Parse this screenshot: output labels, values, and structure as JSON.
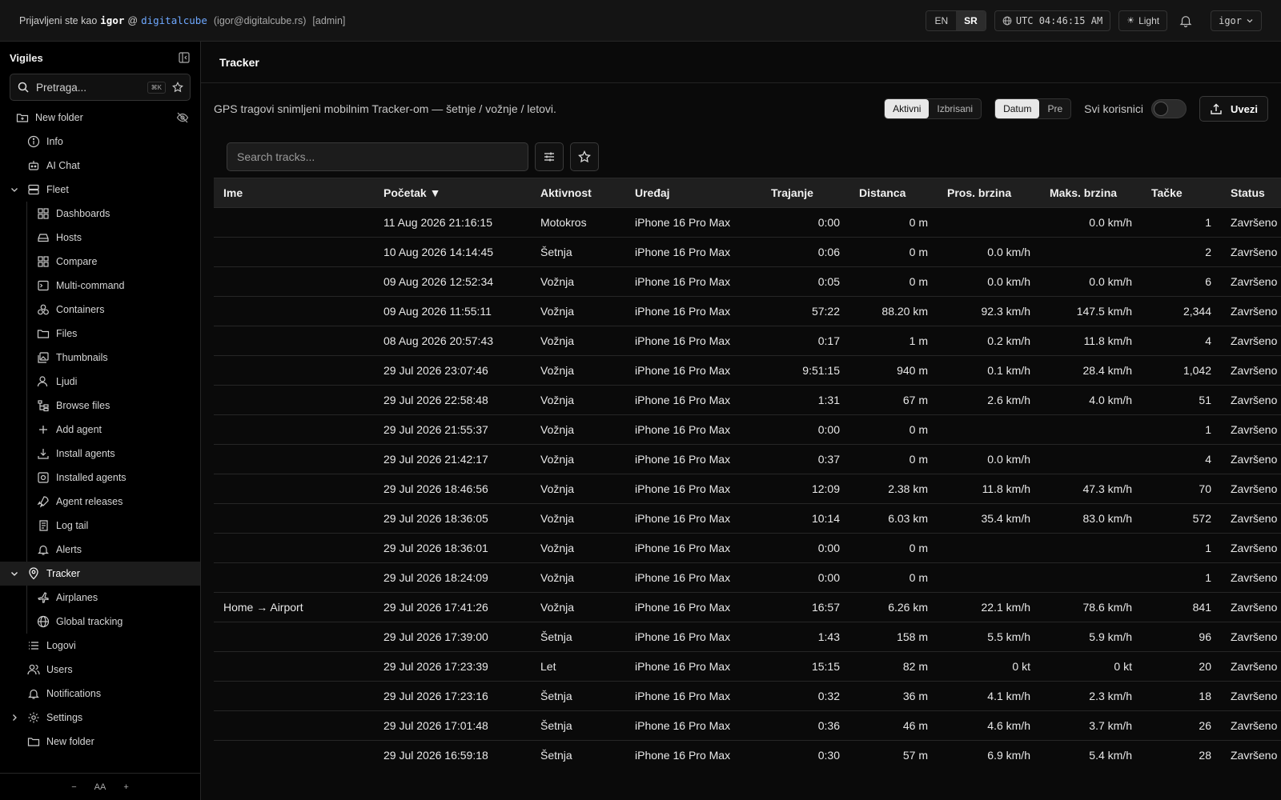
{
  "topbar": {
    "prefix": "Prijavljeni ste kao",
    "user": "igor",
    "at": "@",
    "org": "digitalcube",
    "email": "(igor@digitalcube.rs)",
    "role": "[admin]",
    "lang_en": "EN",
    "lang_sr": "SR",
    "clock": "UTC 04:46:15 AM",
    "theme": "Light",
    "user_menu": "igor"
  },
  "sidebar": {
    "brand": "Vigiles",
    "search_placeholder": "Pretraga...",
    "search_kbd": "⌘K",
    "items": [
      {
        "label": "New folder"
      },
      {
        "label": "Info"
      },
      {
        "label": "AI Chat"
      },
      {
        "label": "Fleet"
      },
      {
        "label": "Dashboards"
      },
      {
        "label": "Hosts"
      },
      {
        "label": "Compare"
      },
      {
        "label": "Multi-command"
      },
      {
        "label": "Containers"
      },
      {
        "label": "Files"
      },
      {
        "label": "Thumbnails"
      },
      {
        "label": "Ljudi"
      },
      {
        "label": "Browse files"
      },
      {
        "label": "Add agent"
      },
      {
        "label": "Install agents"
      },
      {
        "label": "Installed agents"
      },
      {
        "label": "Agent releases"
      },
      {
        "label": "Log tail"
      },
      {
        "label": "Alerts"
      },
      {
        "label": "Tracker"
      },
      {
        "label": "Airplanes"
      },
      {
        "label": "Global tracking"
      },
      {
        "label": "Logovi"
      },
      {
        "label": "Users"
      },
      {
        "label": "Notifications"
      },
      {
        "label": "Settings"
      },
      {
        "label": "New folder"
      }
    ],
    "footer": {
      "minus": "−",
      "aa": "AA",
      "plus": "+"
    }
  },
  "main": {
    "title": "Tracker",
    "description": "GPS tragovi snimljeni mobilnim Tracker-om — šetnje / vožnje / letovi.",
    "filter_active": "Aktivni",
    "filter_deleted": "Izbrisani",
    "sort_date": "Datum",
    "sort_before": "Pre",
    "all_users_label": "Svi korisnici",
    "import_label": "Uvezi",
    "search_placeholder": "Search tracks...",
    "columns": [
      "Ime",
      "Početak ▼",
      "Aktivnost",
      "Uređaj",
      "Trajanje",
      "Distanca",
      "Pros. brzina",
      "Maks. brzina",
      "Tačke",
      "Status"
    ],
    "rows": [
      {
        "name": "",
        "start": "11 Aug 2026 21:16:15",
        "activity": "Motokros",
        "device": "iPhone 16 Pro Max",
        "duration": "0:00",
        "distance": "0 m",
        "avg": "",
        "max": "0.0 km/h",
        "points": "1",
        "status": "Završeno"
      },
      {
        "name": "",
        "start": "10 Aug 2026 14:14:45",
        "activity": "Šetnja",
        "device": "iPhone 16 Pro Max",
        "duration": "0:06",
        "distance": "0 m",
        "avg": "0.0 km/h",
        "max": "",
        "points": "2",
        "status": "Završeno"
      },
      {
        "name": "",
        "start": "09 Aug 2026 12:52:34",
        "activity": "Vožnja",
        "device": "iPhone 16 Pro Max",
        "duration": "0:05",
        "distance": "0 m",
        "avg": "0.0 km/h",
        "max": "0.0 km/h",
        "points": "6",
        "status": "Završeno"
      },
      {
        "name": "",
        "start": "09 Aug 2026 11:55:11",
        "activity": "Vožnja",
        "device": "iPhone 16 Pro Max",
        "duration": "57:22",
        "distance": "88.20 km",
        "avg": "92.3 km/h",
        "max": "147.5 km/h",
        "points": "2,344",
        "status": "Završeno"
      },
      {
        "name": "",
        "start": "08 Aug 2026 20:57:43",
        "activity": "Vožnja",
        "device": "iPhone 16 Pro Max",
        "duration": "0:17",
        "distance": "1 m",
        "avg": "0.2 km/h",
        "max": "11.8 km/h",
        "points": "4",
        "status": "Završeno"
      },
      {
        "name": "",
        "start": "29 Jul 2026 23:07:46",
        "activity": "Vožnja",
        "device": "iPhone 16 Pro Max",
        "duration": "9:51:15",
        "distance": "940 m",
        "avg": "0.1 km/h",
        "max": "28.4 km/h",
        "points": "1,042",
        "status": "Završeno"
      },
      {
        "name": "",
        "start": "29 Jul 2026 22:58:48",
        "activity": "Vožnja",
        "device": "iPhone 16 Pro Max",
        "duration": "1:31",
        "distance": "67 m",
        "avg": "2.6 km/h",
        "max": "4.0 km/h",
        "points": "51",
        "status": "Završeno"
      },
      {
        "name": "",
        "start": "29 Jul 2026 21:55:37",
        "activity": "Vožnja",
        "device": "iPhone 16 Pro Max",
        "duration": "0:00",
        "distance": "0 m",
        "avg": "",
        "max": "",
        "points": "1",
        "status": "Završeno"
      },
      {
        "name": "",
        "start": "29 Jul 2026 21:42:17",
        "activity": "Vožnja",
        "device": "iPhone 16 Pro Max",
        "duration": "0:37",
        "distance": "0 m",
        "avg": "0.0 km/h",
        "max": "",
        "points": "4",
        "status": "Završeno"
      },
      {
        "name": "",
        "start": "29 Jul 2026 18:46:56",
        "activity": "Vožnja",
        "device": "iPhone 16 Pro Max",
        "duration": "12:09",
        "distance": "2.38 km",
        "avg": "11.8 km/h",
        "max": "47.3 km/h",
        "points": "70",
        "status": "Završeno"
      },
      {
        "name": "",
        "start": "29 Jul 2026 18:36:05",
        "activity": "Vožnja",
        "device": "iPhone 16 Pro Max",
        "duration": "10:14",
        "distance": "6.03 km",
        "avg": "35.4 km/h",
        "max": "83.0 km/h",
        "points": "572",
        "status": "Završeno"
      },
      {
        "name": "",
        "start": "29 Jul 2026 18:36:01",
        "activity": "Vožnja",
        "device": "iPhone 16 Pro Max",
        "duration": "0:00",
        "distance": "0 m",
        "avg": "",
        "max": "",
        "points": "1",
        "status": "Završeno"
      },
      {
        "name": "",
        "start": "29 Jul 2026 18:24:09",
        "activity": "Vožnja",
        "device": "iPhone 16 Pro Max",
        "duration": "0:00",
        "distance": "0 m",
        "avg": "",
        "max": "",
        "points": "1",
        "status": "Završeno"
      },
      {
        "name": "Home → Airport",
        "start": "29 Jul 2026 17:41:26",
        "activity": "Vožnja",
        "device": "iPhone 16 Pro Max",
        "duration": "16:57",
        "distance": "6.26 km",
        "avg": "22.1 km/h",
        "max": "78.6 km/h",
        "points": "841",
        "status": "Završeno"
      },
      {
        "name": "",
        "start": "29 Jul 2026 17:39:00",
        "activity": "Šetnja",
        "device": "iPhone 16 Pro Max",
        "duration": "1:43",
        "distance": "158 m",
        "avg": "5.5 km/h",
        "max": "5.9 km/h",
        "points": "96",
        "status": "Završeno"
      },
      {
        "name": "",
        "start": "29 Jul 2026 17:23:39",
        "activity": "Let",
        "device": "iPhone 16 Pro Max",
        "duration": "15:15",
        "distance": "82 m",
        "avg": "0 kt",
        "max": "0 kt",
        "points": "20",
        "status": "Završeno"
      },
      {
        "name": "",
        "start": "29 Jul 2026 17:23:16",
        "activity": "Šetnja",
        "device": "iPhone 16 Pro Max",
        "duration": "0:32",
        "distance": "36 m",
        "avg": "4.1 km/h",
        "max": "2.3 km/h",
        "points": "18",
        "status": "Završeno"
      },
      {
        "name": "",
        "start": "29 Jul 2026 17:01:48",
        "activity": "Šetnja",
        "device": "iPhone 16 Pro Max",
        "duration": "0:36",
        "distance": "46 m",
        "avg": "4.6 km/h",
        "max": "3.7 km/h",
        "points": "26",
        "status": "Završeno"
      },
      {
        "name": "",
        "start": "29 Jul 2026 16:59:18",
        "activity": "Šetnja",
        "device": "iPhone 16 Pro Max",
        "duration": "0:30",
        "distance": "57 m",
        "avg": "6.9 km/h",
        "max": "5.4 km/h",
        "points": "28",
        "status": "Završeno"
      }
    ]
  }
}
